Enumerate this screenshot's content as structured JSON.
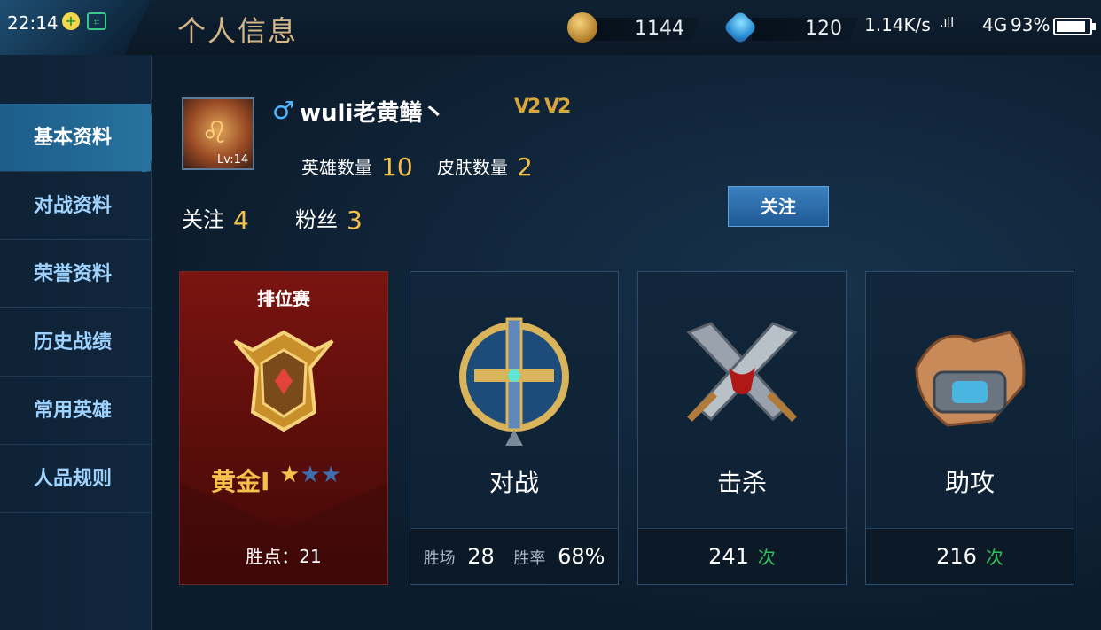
{
  "status_bar": {
    "time": "22:14",
    "net_speed": "1.14K/s",
    "signal": "4G",
    "battery": "93%",
    "battery_level": 0.93
  },
  "header": {
    "title": "个人信息",
    "gold": "1144",
    "diamonds": "120"
  },
  "sidebar": {
    "items": [
      {
        "label": "基本资料",
        "active": true
      },
      {
        "label": "对战资料",
        "active": false
      },
      {
        "label": "荣誉资料",
        "active": false
      },
      {
        "label": "历史战绩",
        "active": false
      },
      {
        "label": "常用英雄",
        "active": false
      },
      {
        "label": "人品规则",
        "active": false
      }
    ]
  },
  "profile": {
    "gender_symbol": "♂",
    "username": "wuli老黄鳝丶",
    "level": "Lv:14",
    "badges": "V2 V2",
    "heroes_label": "英雄数量",
    "heroes_count": "10",
    "skins_label": "皮肤数量",
    "skins_count": "2",
    "following_label": "关注",
    "following_count": "4",
    "fans_label": "粉丝",
    "fans_count": "3",
    "follow_button": "关注"
  },
  "cards": {
    "rank": {
      "title": "排位赛",
      "tier": "黄金I",
      "stars_filled": 1,
      "stars_total": 3,
      "points": "胜点：21"
    },
    "battle": {
      "label": "对战",
      "wins_label": "胜场",
      "wins": "28",
      "rate_label": "胜率",
      "rate": "68%"
    },
    "kills": {
      "label": "击杀",
      "value": "241",
      "unit": "次"
    },
    "assists": {
      "label": "助攻",
      "value": "216",
      "unit": "次"
    }
  },
  "colors": {
    "accent_gold": "#f2c14b",
    "sidebar_text": "#9fd3ff",
    "unit_green": "#32c25d",
    "rank_red": "#7a1410"
  }
}
